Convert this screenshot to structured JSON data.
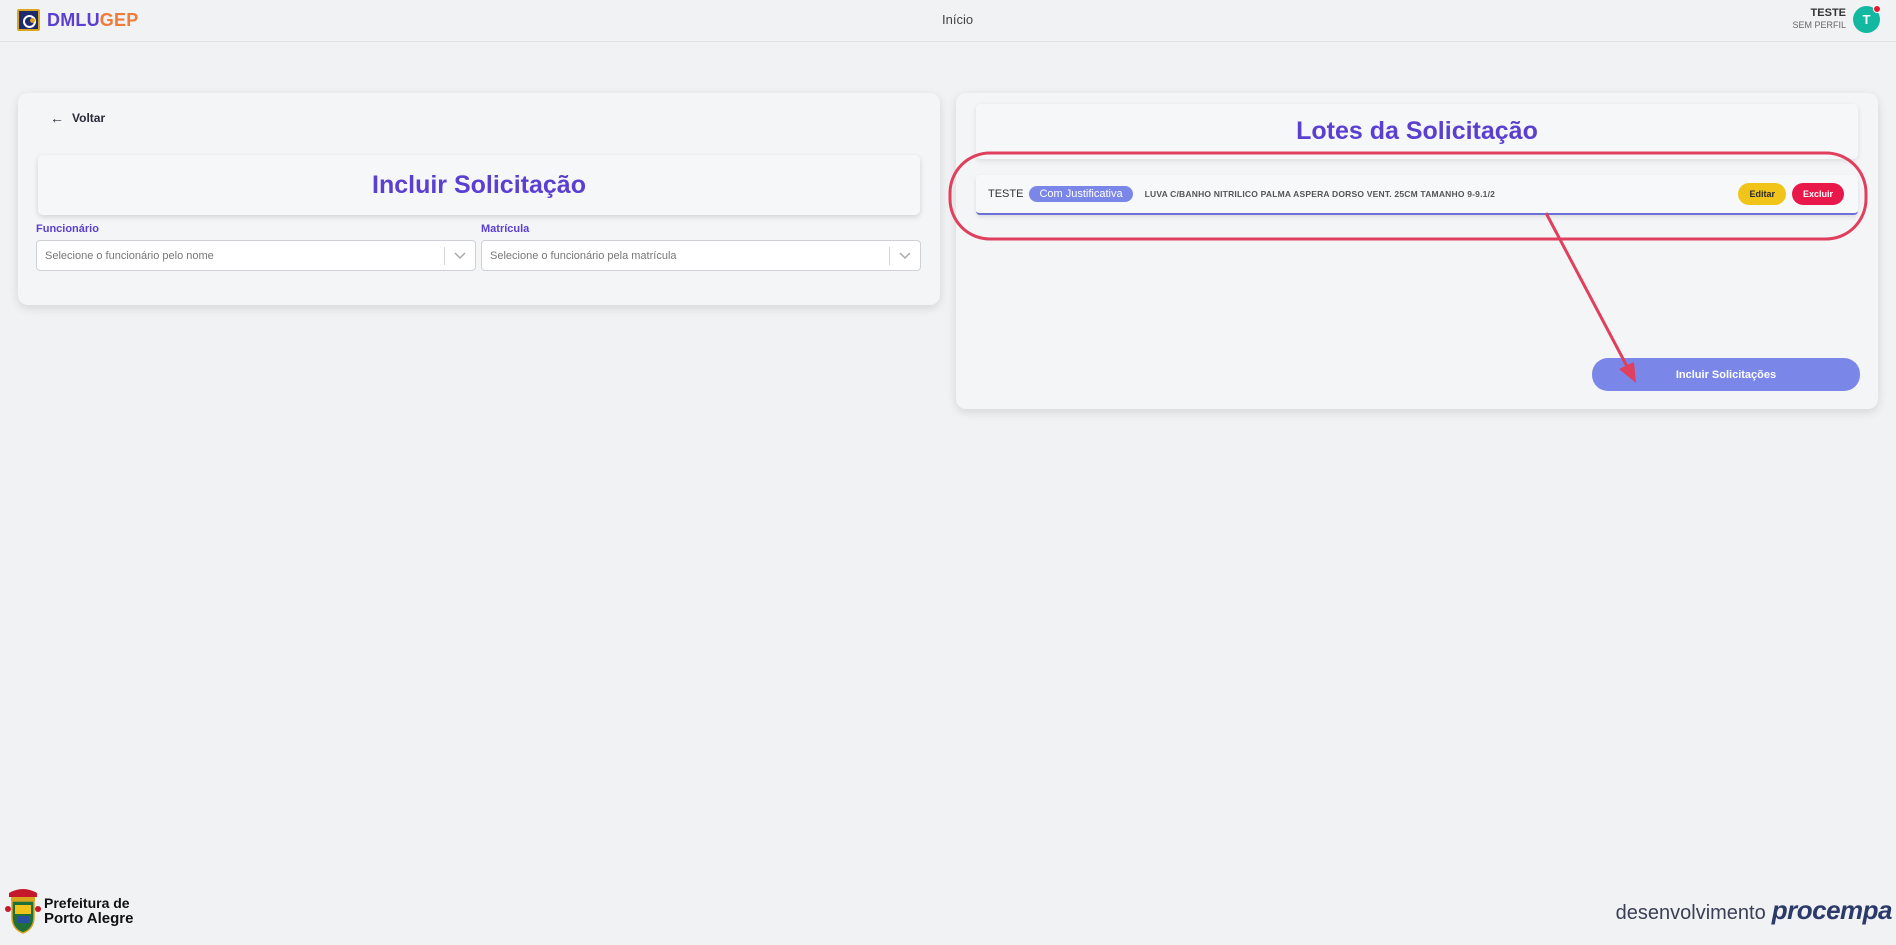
{
  "header": {
    "brand_part1": "DMLU",
    "brand_part2": "GEP",
    "nav_home": "Início",
    "user_name": "TESTE",
    "user_role": "SEM PERFIL",
    "avatar_initial": "T"
  },
  "form": {
    "back_label": "Voltar",
    "title": "Incluir Solicitação",
    "funcionario_label": "Funcionário",
    "funcionario_placeholder": "Selecione o funcionário pelo nome",
    "matricula_label": "Matrícula",
    "matricula_placeholder": "Selecione o funcionário pela matrícula"
  },
  "lotes": {
    "title": "Lotes da Solicitação",
    "items": [
      {
        "name": "TESTE",
        "badge": "Com Justificativa",
        "description": "LUVA C/BANHO NITRILICO PALMA ASPERA DORSO VENT. 25CM TAMANHO 9-9.1/2",
        "edit_label": "Editar",
        "delete_label": "Excluir"
      }
    ],
    "submit_label": "Incluir Solicitações"
  },
  "footer": {
    "prefeitura_line1": "Prefeitura de",
    "prefeitura_line2": "Porto Alegre",
    "dev_label": "desenvolvimento",
    "dev_brand": "procempa"
  },
  "colors": {
    "primary": "#5b3fd0",
    "accent": "#ef7b3a",
    "button_blue": "#7b87e8",
    "edit_yellow": "#f0c418",
    "delete_red": "#e8194a",
    "annotation": "#e0405e",
    "avatar": "#12b8a0"
  }
}
